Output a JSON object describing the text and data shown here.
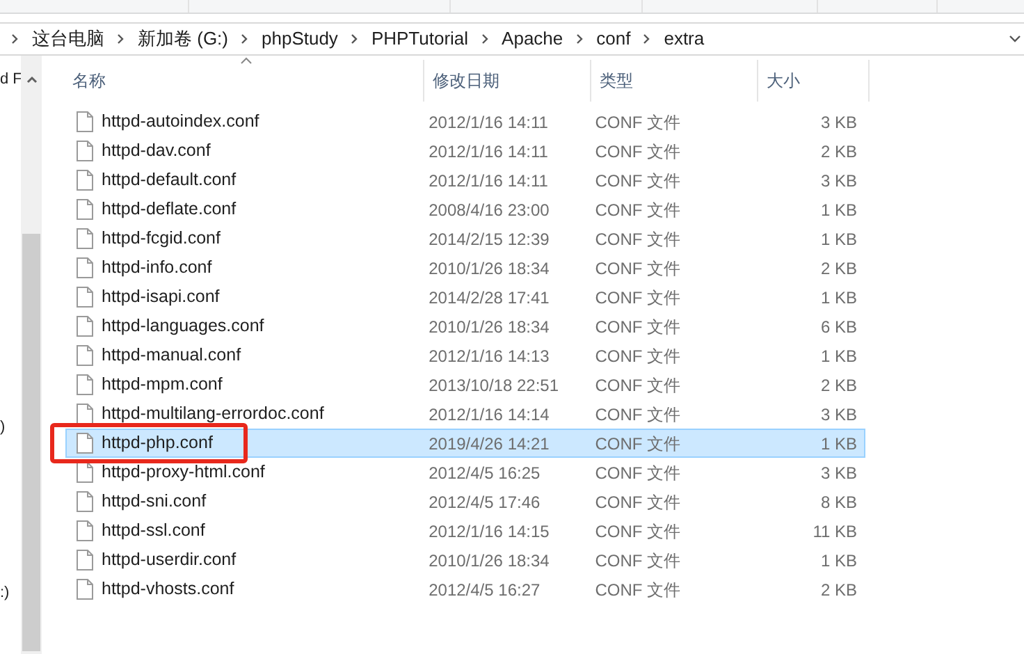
{
  "breadcrumb": [
    "这台电脑",
    "新加卷 (G:)",
    "phpStudy",
    "PHPTutorial",
    "Apache",
    "conf",
    "extra"
  ],
  "nav_pane": {
    "items": [
      "d F",
      ")",
      ":)"
    ]
  },
  "table": {
    "columns": [
      {
        "label": "名称",
        "sorted": true
      },
      {
        "label": "修改日期",
        "sorted": false
      },
      {
        "label": "类型",
        "sorted": false
      },
      {
        "label": "大小",
        "sorted": false
      }
    ],
    "rows": [
      {
        "name": "httpd-autoindex.conf",
        "date": "2012/1/16 14:11",
        "type": "CONF 文件",
        "size": "3 KB",
        "selected": false,
        "annotated": false
      },
      {
        "name": "httpd-dav.conf",
        "date": "2012/1/16 14:11",
        "type": "CONF 文件",
        "size": "2 KB",
        "selected": false,
        "annotated": false
      },
      {
        "name": "httpd-default.conf",
        "date": "2012/1/16 14:11",
        "type": "CONF 文件",
        "size": "3 KB",
        "selected": false,
        "annotated": false
      },
      {
        "name": "httpd-deflate.conf",
        "date": "2008/4/16 23:00",
        "type": "CONF 文件",
        "size": "1 KB",
        "selected": false,
        "annotated": false
      },
      {
        "name": "httpd-fcgid.conf",
        "date": "2014/2/15 12:39",
        "type": "CONF 文件",
        "size": "1 KB",
        "selected": false,
        "annotated": false
      },
      {
        "name": "httpd-info.conf",
        "date": "2010/1/26 18:34",
        "type": "CONF 文件",
        "size": "2 KB",
        "selected": false,
        "annotated": false
      },
      {
        "name": "httpd-isapi.conf",
        "date": "2014/2/28 17:41",
        "type": "CONF 文件",
        "size": "1 KB",
        "selected": false,
        "annotated": false
      },
      {
        "name": "httpd-languages.conf",
        "date": "2010/1/26 18:34",
        "type": "CONF 文件",
        "size": "6 KB",
        "selected": false,
        "annotated": false
      },
      {
        "name": "httpd-manual.conf",
        "date": "2012/1/16 14:13",
        "type": "CONF 文件",
        "size": "1 KB",
        "selected": false,
        "annotated": false
      },
      {
        "name": "httpd-mpm.conf",
        "date": "2013/10/18 22:51",
        "type": "CONF 文件",
        "size": "2 KB",
        "selected": false,
        "annotated": false
      },
      {
        "name": "httpd-multilang-errordoc.conf",
        "date": "2012/1/16 14:14",
        "type": "CONF 文件",
        "size": "3 KB",
        "selected": false,
        "annotated": false
      },
      {
        "name": "httpd-php.conf",
        "date": "2019/4/26 14:21",
        "type": "CONF 文件",
        "size": "1 KB",
        "selected": true,
        "annotated": true
      },
      {
        "name": "httpd-proxy-html.conf",
        "date": "2012/4/5 16:25",
        "type": "CONF 文件",
        "size": "3 KB",
        "selected": false,
        "annotated": false
      },
      {
        "name": "httpd-sni.conf",
        "date": "2012/4/5 17:46",
        "type": "CONF 文件",
        "size": "8 KB",
        "selected": false,
        "annotated": false
      },
      {
        "name": "httpd-ssl.conf",
        "date": "2012/1/16 14:15",
        "type": "CONF 文件",
        "size": "11 KB",
        "selected": false,
        "annotated": false
      },
      {
        "name": "httpd-userdir.conf",
        "date": "2010/1/26 18:34",
        "type": "CONF 文件",
        "size": "1 KB",
        "selected": false,
        "annotated": false
      },
      {
        "name": "httpd-vhosts.conf",
        "date": "2012/4/5 16:27",
        "type": "CONF 文件",
        "size": "2 KB",
        "selected": false,
        "annotated": false
      }
    ]
  }
}
